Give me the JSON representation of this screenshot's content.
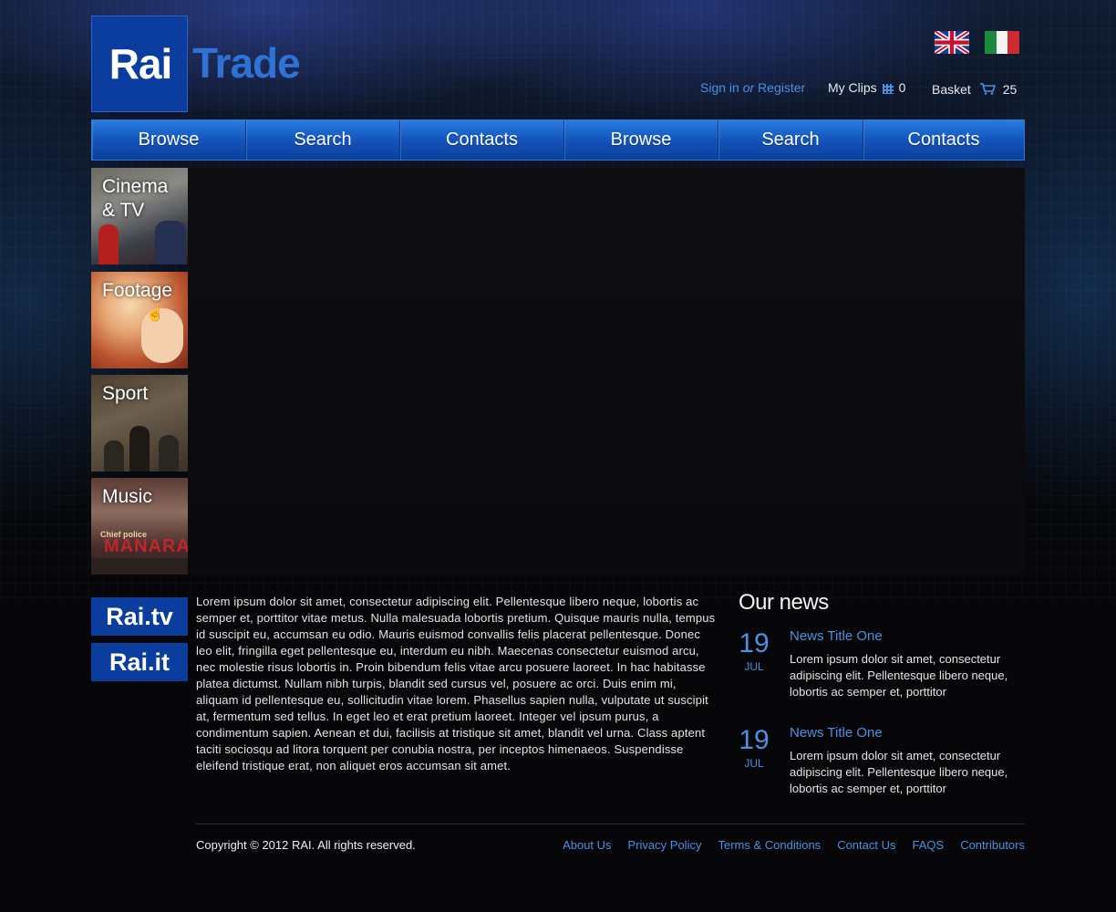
{
  "header": {
    "logo_rai": "Rai",
    "logo_trade": "Trade",
    "flags": [
      "uk-flag-icon",
      "italy-flag-icon"
    ]
  },
  "userbar": {
    "sign_in": "Sign in",
    "or": "or",
    "register": "Register",
    "my_clips_label": "My Clips",
    "my_clips_count": "0",
    "basket_label": "Basket",
    "basket_count": "25"
  },
  "nav": {
    "items": [
      "Browse",
      "Search",
      "Contacts",
      "Browse",
      "Search",
      "Contacts"
    ]
  },
  "categories": [
    {
      "label": "Cinema\n& TV"
    },
    {
      "label": "Footage"
    },
    {
      "label": "Sport"
    },
    {
      "label": "Music"
    }
  ],
  "music_poster": {
    "line1": "Chief police",
    "line2": "MANARA"
  },
  "brands": [
    "Rai.tv",
    "Rai.it"
  ],
  "main_text": "Lorem ipsum dolor sit amet, consectetur adipiscing elit. Pellentesque libero neque, lobortis ac semper et, porttitor vitae metus. Nulla malesuada lobortis pretium. Quisque mauris nulla, tempus id suscipit eu, accumsan eu odio. Mauris euismod convallis felis placerat pellentesque. Donec leo elit, fringilla eget pellentesque eu, interdum eu nibh. Maecenas consectetur euismod arcu, nec molestie risus lobortis in. Proin bibendum felis vitae arcu posuere laoreet. In hac habitasse platea dictumst. Nullam nibh turpis, blandit sed cursus vel, posuere ac orci. Duis enim mi, aliquam id pellentesque eu, sollicitudin vitae lorem. Phasellus sapien nulla, vulputate ut suscipit at, fermentum sed tellus. In eget leo et erat pretium laoreet. Integer vel ipsum purus, a condimentum sapien. Aenean et dui, facilisis at tristique sit amet, blandit vel urna. Class aptent taciti sociosqu ad litora torquent per conubia nostra, per inceptos himenaeos. Suspendisse eleifend tristique erat, non aliquet eros accumsan sit amet.",
  "news": {
    "title": "Our news",
    "items": [
      {
        "day": "19",
        "month": "JUL",
        "title": "News Title One",
        "text": "Lorem ipsum dolor sit amet, consectetur adipiscing elit. Pellentesque libero neque, lobortis ac semper et, porttitor"
      },
      {
        "day": "19",
        "month": "JUL",
        "title": "News Title One",
        "text": "Lorem ipsum dolor sit amet, consectetur adipiscing elit. Pellentesque libero neque, lobortis ac semper et, porttitor"
      }
    ]
  },
  "footer": {
    "copyright": "Copyright © 2012 RAI. All rights reserved.",
    "links": [
      "About Us",
      "Privacy Policy",
      "Terms & Conditions",
      "Contact Us",
      "FAQS",
      "Contributors"
    ]
  },
  "colors": {
    "accent": "#4d8fe0",
    "brand_blue": "#0b3d9e",
    "nav_blue": "#1454bb"
  }
}
